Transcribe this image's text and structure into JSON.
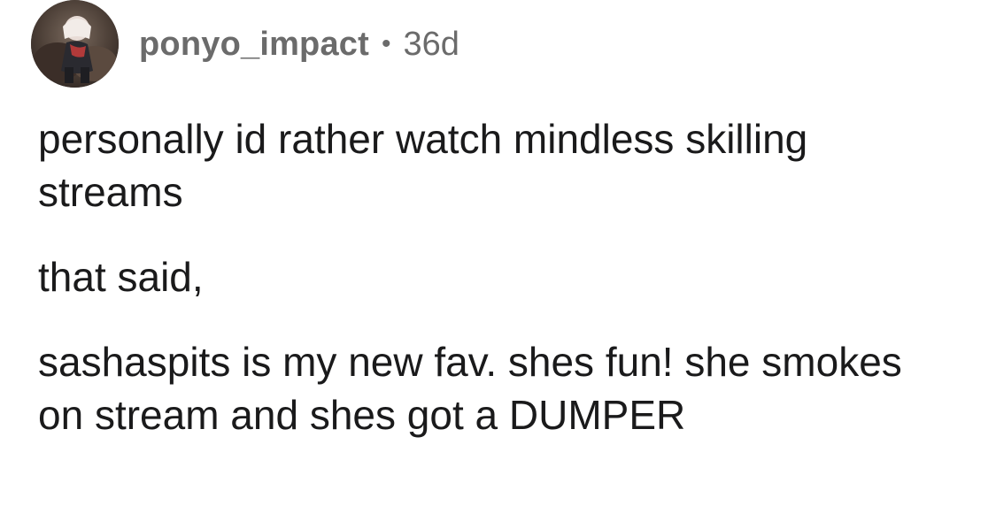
{
  "comment": {
    "author": "ponyo_impact",
    "separator": "•",
    "age": "36d",
    "avatar_icon": "user-avatar",
    "paragraphs": [
      "personally id rather watch mindless skilling streams",
      "that said,",
      "sashaspits is my new fav. shes fun! she smokes on stream and shes got a DUMPER"
    ]
  }
}
